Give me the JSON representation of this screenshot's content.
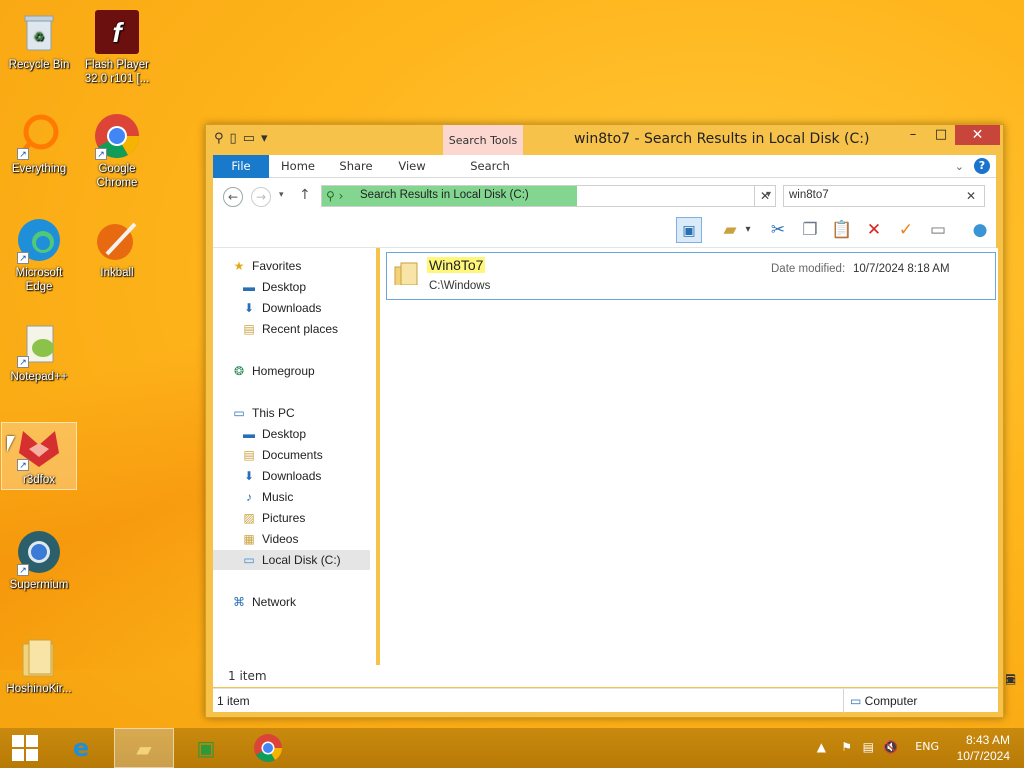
{
  "desktop": {
    "icons": [
      {
        "label": "Recycle Bin",
        "icon": "recycle-bin-icon"
      },
      {
        "label": "Flash Player 32.0 r101 [...",
        "icon": "flash-player-icon"
      },
      {
        "label": "Everything",
        "icon": "everything-icon"
      },
      {
        "label": "Google Chrome",
        "icon": "chrome-icon"
      },
      {
        "label": "Microsoft Edge",
        "icon": "edge-icon"
      },
      {
        "label": "Inkball",
        "icon": "inkball-icon"
      },
      {
        "label": "Notepad++",
        "icon": "notepadpp-icon"
      },
      {
        "label": "r3dfox",
        "icon": "r3dfox-icon"
      },
      {
        "label": "Supermium",
        "icon": "supermium-icon"
      },
      {
        "label": "HoshinoKir...",
        "icon": "folder-icon"
      }
    ]
  },
  "window": {
    "title": "win8to7 - Search Results in Local Disk (C:)",
    "context_tab": "Search Tools",
    "controls": {
      "minimize": "–",
      "maximize": "□",
      "close": "✕"
    }
  },
  "ribbon": {
    "tabs": [
      "File",
      "Home",
      "Share",
      "View",
      "Search"
    ]
  },
  "address": {
    "path": "Search Results in Local Disk (C:)",
    "search_value": "win8to7"
  },
  "nav": {
    "favorites": "Favorites",
    "fav_desktop": "Desktop",
    "fav_downloads": "Downloads",
    "fav_recent": "Recent places",
    "homegroup": "Homegroup",
    "thispc": "This PC",
    "pc_desktop": "Desktop",
    "pc_documents": "Documents",
    "pc_downloads": "Downloads",
    "pc_music": "Music",
    "pc_pictures": "Pictures",
    "pc_videos": "Videos",
    "pc_localdisk": "Local Disk (C:)",
    "network": "Network"
  },
  "results": [
    {
      "name": "Win8To7",
      "path": "C:\\Windows",
      "date_label": "Date modified:",
      "date": "10/7/2024 8:18 AM"
    }
  ],
  "status": {
    "inner_count": "1 item",
    "count": "1 item",
    "location": "Computer"
  },
  "taskbar": {
    "lang": "ENG",
    "time": "8:43 AM",
    "date": "10/7/2024"
  }
}
